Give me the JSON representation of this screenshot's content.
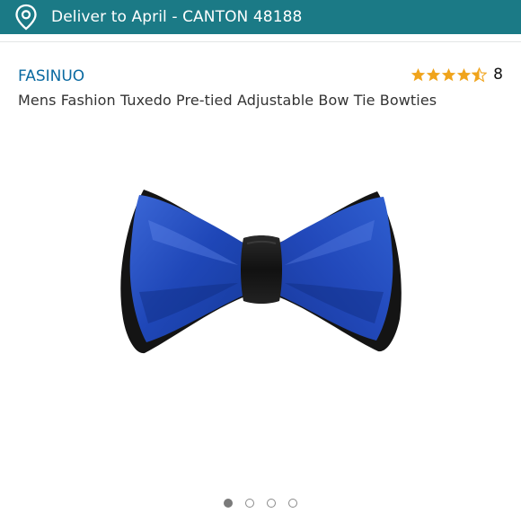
{
  "header": {
    "deliver_text": "Deliver to April - CANTON 48188",
    "pin_icon": "location-pin-icon",
    "background_color": "#1b7a86"
  },
  "product": {
    "brand": "FASINUO",
    "title": "Mens Fashion Tuxedo Pre-tied Adjustable Bow Tie Bowties",
    "rating_stars": 4.5,
    "rating_count": "8",
    "image": "blue-black-bow-tie",
    "brand_color": "#0a6aa1",
    "star_color": "#f0a41c"
  },
  "carousel": {
    "page_count": 4,
    "active_index": 0
  }
}
